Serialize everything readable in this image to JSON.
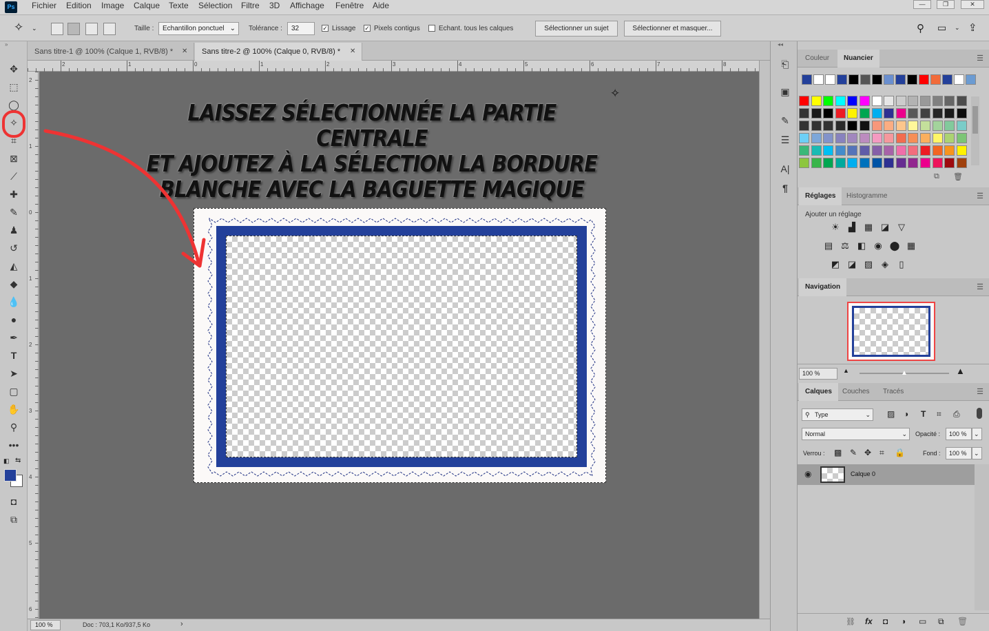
{
  "app": {
    "logo": "Ps"
  },
  "menu": [
    "Fichier",
    "Edition",
    "Image",
    "Calque",
    "Texte",
    "Sélection",
    "Filtre",
    "3D",
    "Affichage",
    "Fenêtre",
    "Aide"
  ],
  "window_controls": {
    "minimize": "—",
    "restore": "❐",
    "close": "✕"
  },
  "options": {
    "size_label": "Taille :",
    "size_value": "Echantillon ponctuel",
    "tolerance_label": "Tolérance :",
    "tolerance_value": "32",
    "antialias_label": "Lissage",
    "antialias_checked": true,
    "contiguous_label": "Pixels contigus",
    "contiguous_checked": true,
    "sample_all_label": "Echant. tous les calques",
    "sample_all_checked": false,
    "select_subject": "Sélectionner un sujet",
    "select_mask": "Sélectionner et masquer..."
  },
  "tabs": [
    {
      "label": "Sans titre-1 @ 100% (Calque 1, RVB/8) *",
      "active": false
    },
    {
      "label": "Sans titre-2 @ 100% (Calque 0, RVB/8) *",
      "active": true
    }
  ],
  "ruler_top": [
    "2",
    "1",
    "0",
    "1",
    "2",
    "3",
    "4",
    "5",
    "6",
    "7",
    "8"
  ],
  "ruler_left": [
    "2",
    "1",
    "0",
    "1",
    "2",
    "3",
    "4",
    "5",
    "6"
  ],
  "instruction": {
    "line1": "LAISSEZ SÉLECTIONNÉE LA PARTIE CENTRALE",
    "line2": "ET AJOUTEZ À LA SÉLECTION LA BORDURE",
    "line3": "BLANCHE AVEC LA BAGUETTE MAGIQUE"
  },
  "colors": {
    "frame_blue": "#23409a",
    "foreground": "#23409a",
    "background": "#ffffff",
    "highlight": "#ee3333"
  },
  "status": {
    "zoom": "100 %",
    "doc": "Doc : 703,1 Ko/937,5 Ko",
    "arrow": "›"
  },
  "panel_color": {
    "tabs": [
      "Couleur",
      "Nuancier"
    ],
    "active": "Nuancier"
  },
  "swatches": {
    "recent": [
      "#23409a",
      "#ffffff",
      "#ffffff",
      "#23409a",
      "#000000",
      "#555555",
      "#000000",
      "#6a8fcf",
      "#23409a",
      "#000000",
      "#ff0000",
      "#f26b3a",
      "#23409a",
      "#ffffff",
      "#6b9bd2"
    ],
    "grid": [
      [
        "#ff0000",
        "#ffff00",
        "#00ff00",
        "#00ffff",
        "#0000ff",
        "#ff00ff",
        "#ffffff",
        "#e6e6e6",
        "#cccccc",
        "#b3b3b3",
        "#999999",
        "#808080",
        "#666666",
        "#4d4d4d"
      ],
      [
        "#333333",
        "#1a1a1a",
        "#000000",
        "#ed1c24",
        "#fff200",
        "#00a651",
        "#00aeef",
        "#2e3192",
        "#ec008c",
        "#595959",
        "#404040",
        "#262626",
        "#1a1a1a",
        "#0d0d0d"
      ],
      [
        "#333333",
        "#333333",
        "#333333",
        "#2a2a2a",
        "#000000",
        "#111111",
        "#f7977a",
        "#fbad82",
        "#fdc68c",
        "#fff79a",
        "#c4df9b",
        "#a3d39c",
        "#82ca9c",
        "#7accc8"
      ],
      [
        "#6dcff6",
        "#7da7d9",
        "#8393ca",
        "#8882be",
        "#a187be",
        "#bc8cbf",
        "#f49ac1",
        "#f5989d",
        "#f26c4f",
        "#f68e56",
        "#fbaf5d",
        "#fff568",
        "#acd372",
        "#7cc576"
      ],
      [
        "#3bb878",
        "#1abbb4",
        "#00bff3",
        "#448ccb",
        "#5574b9",
        "#605ca8",
        "#855fa8",
        "#a763a8",
        "#f06eaa",
        "#f26d7d",
        "#ed1c24",
        "#f26522",
        "#f7941d",
        "#fff200"
      ],
      [
        "#8dc63f",
        "#39b54a",
        "#00a651",
        "#00a99d",
        "#00aeef",
        "#0072bc",
        "#0054a6",
        "#2e3192",
        "#662d91",
        "#92278f",
        "#ec008c",
        "#ed145b",
        "#9e0b0f",
        "#a0410d"
      ]
    ]
  },
  "panel_adjust": {
    "tabs": [
      "Réglages",
      "Histogramme"
    ],
    "active": "Réglages",
    "subtitle": "Ajouter un réglage",
    "row1": [
      "☀",
      "▟",
      "▦",
      "◪",
      "▽"
    ],
    "row2": [
      "▤",
      "⚖",
      "◧",
      "◉",
      "⬤",
      "▦"
    ],
    "row3": [
      "◩",
      "◪",
      "▨",
      "◈",
      "▯"
    ]
  },
  "panel_nav": {
    "title": "Navigation",
    "zoom": "100 %"
  },
  "panel_layers": {
    "tabs": [
      "Calques",
      "Couches",
      "Tracés"
    ],
    "active": "Calques",
    "filter": "Type",
    "blend": "Normal",
    "opacity_label": "Opacité :",
    "opacity": "100 %",
    "lock_label": "Verrou :",
    "fill_label": "Fond :",
    "fill": "100 %",
    "layers": [
      {
        "name": "Calque 0",
        "visible": true
      }
    ]
  }
}
